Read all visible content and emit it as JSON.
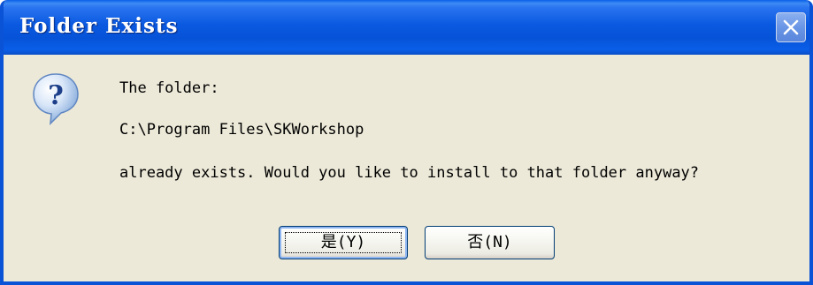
{
  "dialog": {
    "title": "Folder Exists",
    "message_line1": "The folder:",
    "message_line2": "C:\\Program Files\\SKWorkshop",
    "message_line3": "already exists. Would you like to install to that folder anyway?",
    "icon": "question-icon",
    "buttons": {
      "yes_label": "是(Y)",
      "no_label": "否(N)"
    }
  },
  "colors": {
    "titlebar": "#0a59e0",
    "frame": "#0a52d6",
    "background": "#ece9d8"
  }
}
